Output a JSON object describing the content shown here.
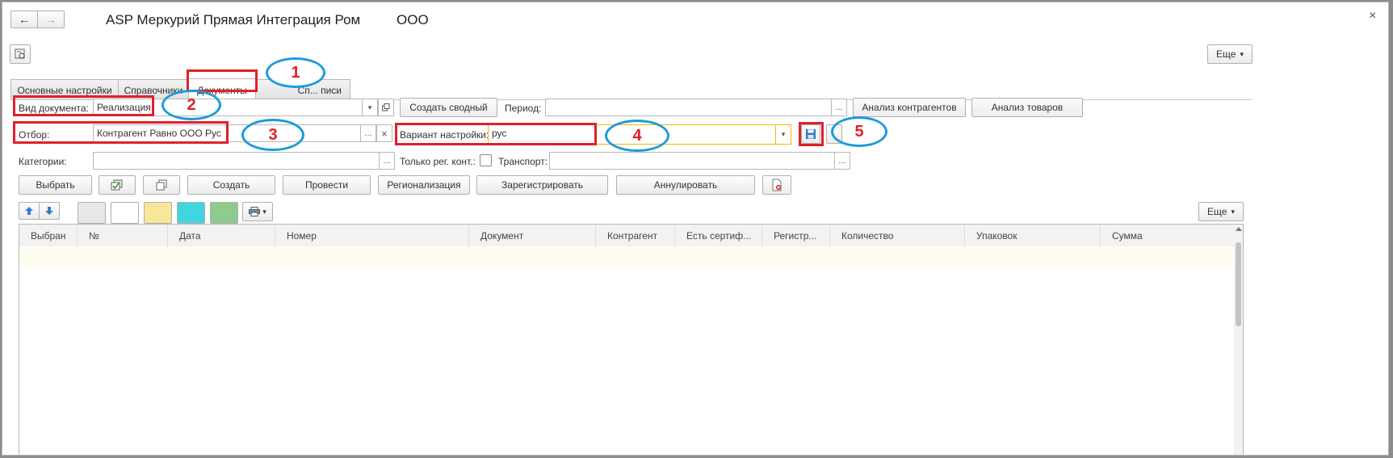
{
  "window": {
    "title": "ASP Меркурий Прямая Интеграция Ром",
    "title_org": "ООО",
    "close_glyph": "×"
  },
  "nav": {
    "back_glyph": "🡐",
    "forward_glyph": "🡒"
  },
  "toolbar": {
    "more_label": "Еще",
    "dropdown_glyph": "▾"
  },
  "tabs": [
    {
      "label": "Основные настройки",
      "active": false
    },
    {
      "label": "Справочники",
      "active": false
    },
    {
      "label": "Документы",
      "active": true
    },
    {
      "label": "Сп... писи",
      "active": false
    }
  ],
  "filters": {
    "doc_type_label": "Вид документа:",
    "doc_type_value": "Реализация",
    "create_summary_button": "Создать сводный",
    "period_label": "Период:",
    "period_value": "",
    "analyze_contractors_button": "Анализ контрагентов",
    "analyze_goods_button": "Анализ товаров",
    "selection_label": "Отбор:",
    "selection_value": "Контрагент Равно  ООО Рус",
    "variant_label": "Вариант настройки:",
    "variant_value": "рус",
    "categories_label": "Категории:",
    "categories_value": "",
    "reg_only_label": "Только рег. конт.:",
    "reg_only_checked": false,
    "transport_label": "Транспорт:",
    "transport_value": "",
    "ellipsis": "...",
    "clear_glyph": "×"
  },
  "actions": {
    "select": "Выбрать",
    "create": "Создать",
    "post": "Провести",
    "regionalize": "Регионализация",
    "register": "Зарегистрировать",
    "cancel": "Аннулировать"
  },
  "table": {
    "more_label": "Еще",
    "columns": [
      "Выбран",
      "№",
      "Дата",
      "Номер",
      "Документ",
      "Контрагент",
      "Есть сертиф...",
      "Регистр...",
      "Количество",
      "Упаковок",
      "Сумма"
    ],
    "rows": []
  },
  "swatch_colors": [
    "#e8e8e8",
    "#ffffff",
    "#f8e79a",
    "#3fd6df",
    "#8fcb8c"
  ],
  "annotations": [
    "1",
    "2",
    "3",
    "4",
    "5"
  ],
  "accent_colors": {
    "annotation_box": "#e0202a",
    "annotation_ellipse": "#1c9bd9",
    "focus_border": "#f2b900"
  }
}
